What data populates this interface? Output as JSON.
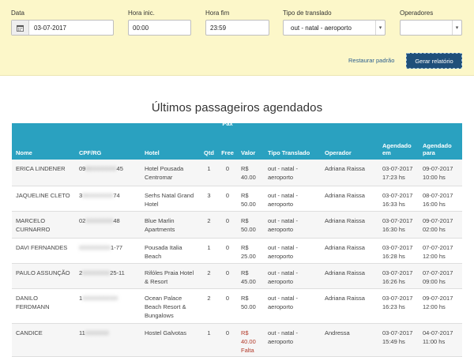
{
  "filters": {
    "data_label": "Data",
    "data_value": "03-07-2017",
    "hora_inic_label": "Hora inic.",
    "hora_inic_value": "00:00",
    "hora_fim_label": "Hora fim",
    "hora_fim_value": "23:59",
    "tipo_label": "Tipo de translado",
    "tipo_value": "out - natal - aeroporto",
    "operadores_label": "Operadores",
    "operadores_value": "",
    "restore_label": "Restaurar padrão",
    "report_label": "Gerar relatório"
  },
  "section_title": "Últimos passageiros agendados",
  "table": {
    "pax_label": "Pax",
    "headers": {
      "nome": "Nome",
      "cpf": "CPF/RG",
      "hotel": "Hotel",
      "qtd": "Qtd",
      "free": "Free",
      "valor": "Valor",
      "tipo": "Tipo Translado",
      "operador": "Operador",
      "agendado_em": "Agendado em",
      "agendado_para": "Agendado para"
    },
    "rows": [
      {
        "nome": "ERICA LINDENER",
        "cpf_start": "09",
        "cpf_mid": "8XXXXXXX",
        "cpf_end": "45",
        "hotel": "Hotel Pousada Centromar",
        "qtd": "1",
        "free": "0",
        "valor": "R$ 40.00",
        "falta": "",
        "tipo": "out - natal - aeroporto",
        "operador": "Adriana Raissa",
        "em": "03-07-2017 17:23 hs",
        "para": "09-07-2017 10:00 hs"
      },
      {
        "nome": "JAQUELINE CLETO",
        "cpf_start": "3",
        "cpf_mid": "0XXXXXXX",
        "cpf_end": "74",
        "hotel": "Serhs Natal Grand Hotel",
        "qtd": "3",
        "free": "0",
        "valor": "R$ 50.00",
        "falta": "",
        "tipo": "out - natal - aeroporto",
        "operador": "Adriana Raissa",
        "em": "03-07-2017 16:33 hs",
        "para": "08-07-2017 16:00 hs"
      },
      {
        "nome": "MARCELO CURNARRO",
        "cpf_start": "02",
        "cpf_mid": "XXXXXXX",
        "cpf_end": "48",
        "hotel": "Blue Marlin Apartments",
        "qtd": "2",
        "free": "0",
        "valor": "R$ 50.00",
        "falta": "",
        "tipo": "out - natal - aeroporto",
        "operador": "Adriana Raissa",
        "em": "03-07-2017 16:30 hs",
        "para": "09-07-2017 02:00 hs"
      },
      {
        "nome": "DAVI FERNANDES",
        "cpf_start": "",
        "cpf_mid": "XXXXXXXX",
        "cpf_end": "1-77",
        "hotel": "Pousada Italia Beach",
        "qtd": "1",
        "free": "0",
        "valor": "R$ 25.00",
        "falta": "",
        "tipo": "out - natal - aeroporto",
        "operador": "Adriana Raissa",
        "em": "03-07-2017 16:28 hs",
        "para": "07-07-2017 12:00 hs"
      },
      {
        "nome": "PAULO ASSUNÇÃO",
        "cpf_start": "2",
        "cpf_mid": "XXXXXXX",
        "cpf_end": "25-11",
        "hotel": "Rifóles Praia Hotel & Resort",
        "qtd": "2",
        "free": "0",
        "valor": "R$ 45.00",
        "falta": "",
        "tipo": "out - natal - aeroporto",
        "operador": "Adriana Raissa",
        "em": "03-07-2017 16:26 hs",
        "para": "07-07-2017 09:00 hs"
      },
      {
        "nome": "DANILO FERDMANN",
        "cpf_start": "1",
        "cpf_mid": "XXXXXXXXX",
        "cpf_end": "",
        "hotel": "Ocean Palace Beach Resort & Bungalows",
        "qtd": "2",
        "free": "0",
        "valor": "R$ 50.00",
        "falta": "",
        "tipo": "out - natal - aeroporto",
        "operador": "Adriana Raissa",
        "em": "03-07-2017 16:23 hs",
        "para": "09-07-2017 12:00 hs"
      },
      {
        "nome": "CANDICE",
        "cpf_start": "11",
        "cpf_mid": "XXXXXX",
        "cpf_end": "",
        "hotel": "Hostel Galvotas",
        "qtd": "1",
        "free": "0",
        "valor": "R$ 40.00",
        "falta": "Falta",
        "tipo": "out - natal - aeroporto",
        "operador": "Andressa",
        "em": "03-07-2017 15:49 hs",
        "para": "04-07-2017 11:00 hs"
      }
    ]
  },
  "colors": {
    "filter_bg": "#fcf7c9",
    "header_bg": "#2aa1c0",
    "button_bg": "#1f4f7a",
    "link": "#2b5e8e"
  }
}
